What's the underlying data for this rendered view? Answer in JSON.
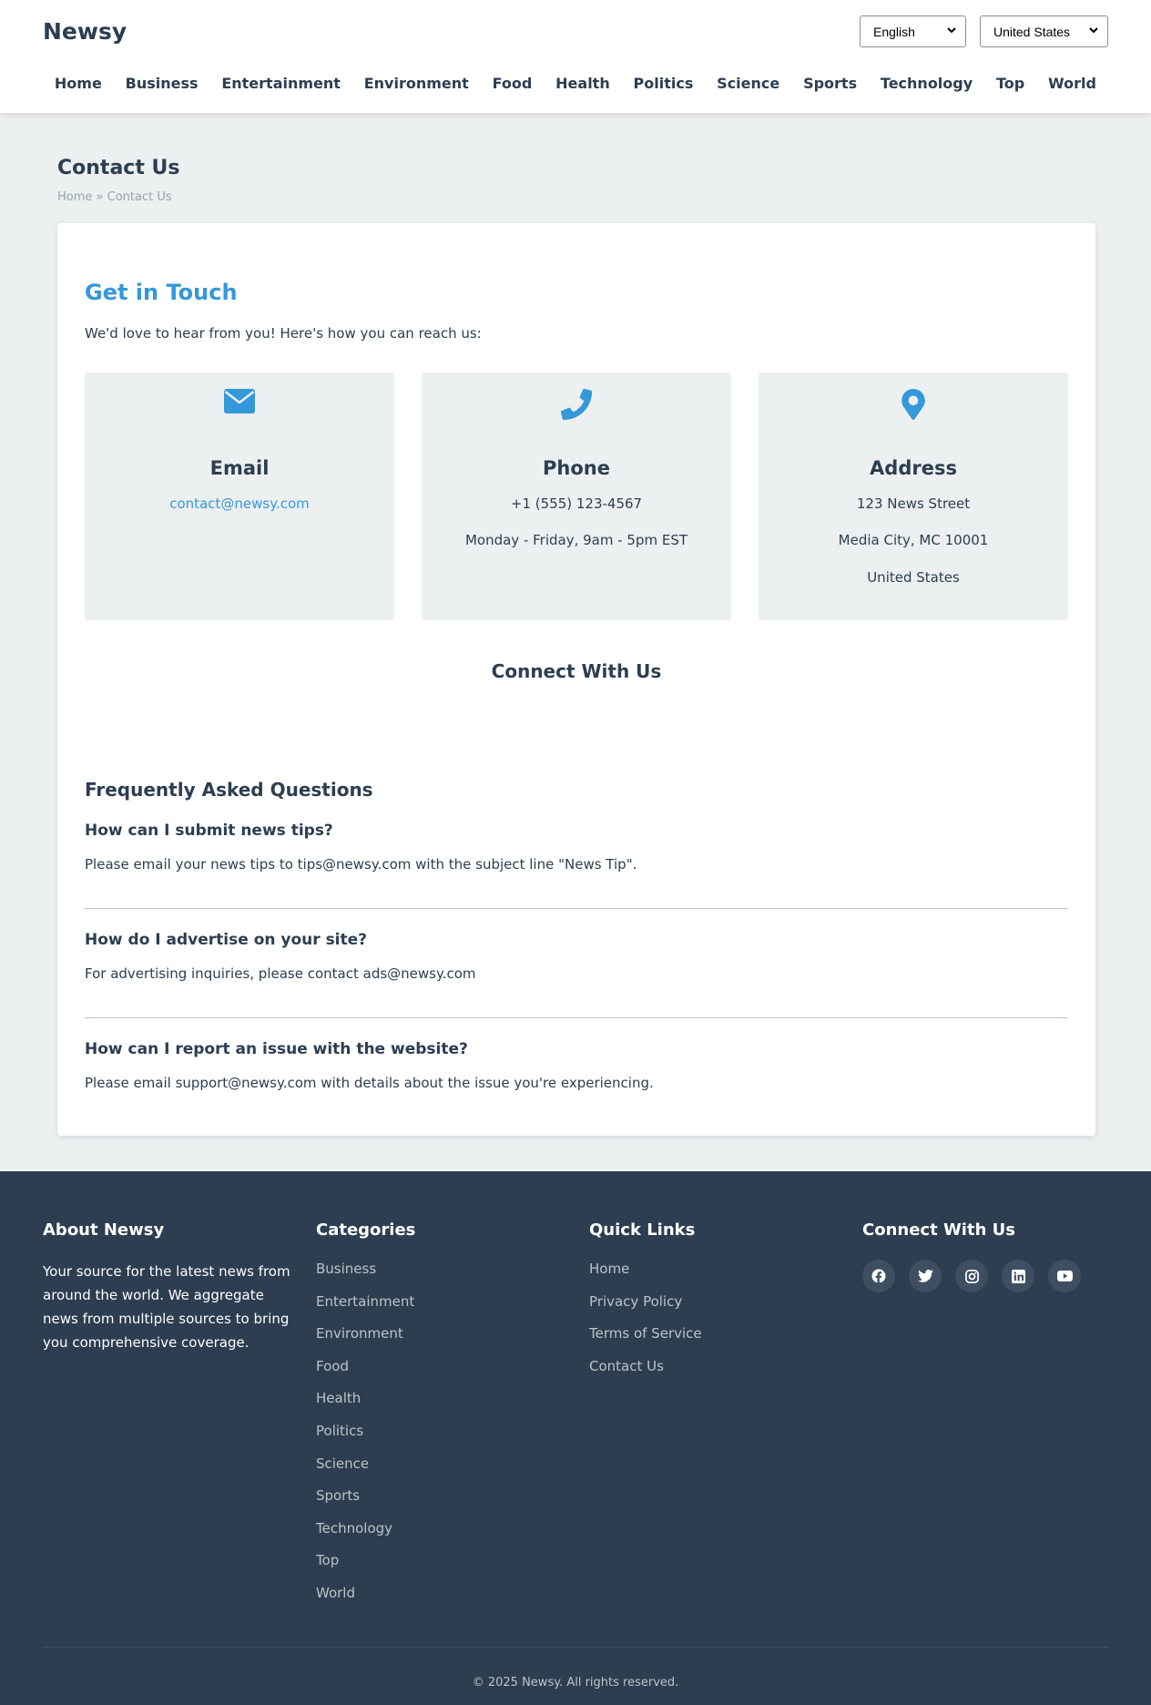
{
  "header": {
    "brand": "Newsy",
    "language_select": "English",
    "country_select": "United States",
    "nav": [
      "Home",
      "Business",
      "Entertainment",
      "Environment",
      "Food",
      "Health",
      "Politics",
      "Science",
      "Sports",
      "Technology",
      "Top",
      "World"
    ]
  },
  "page": {
    "title": "Contact Us",
    "breadcrumb_home": "Home",
    "breadcrumb_sep": "»",
    "breadcrumb_current": "Contact Us"
  },
  "contact": {
    "heading": "Get in Touch",
    "intro": "We'd love to hear from you! Here's how you can reach us:",
    "email": {
      "title": "Email",
      "value": "contact@newsy.com",
      "icon": "envelope-icon"
    },
    "phone": {
      "title": "Phone",
      "number": "+1 (555) 123-4567",
      "hours": "Monday - Friday, 9am - 5pm EST",
      "icon": "phone-icon"
    },
    "address": {
      "title": "Address",
      "street": "123 News Street",
      "city": "Media City, MC 10001",
      "country": "United States",
      "icon": "map-pin-icon"
    },
    "connect_heading": "Connect With Us"
  },
  "faq": {
    "heading": "Frequently Asked Questions",
    "items": [
      {
        "q": "How can I submit news tips?",
        "a": "Please email your news tips to tips@newsy.com with the subject line \"News Tip\"."
      },
      {
        "q": "How do I advertise on your site?",
        "a": "For advertising inquiries, please contact ads@newsy.com"
      },
      {
        "q": "How can I report an issue with the website?",
        "a": "Please email support@newsy.com with details about the issue you're experiencing."
      }
    ]
  },
  "footer": {
    "about_title": "About Newsy",
    "about_text": "Your source for the latest news from around the world. We aggregate news from multiple sources to bring you comprehensive coverage.",
    "categories_title": "Categories",
    "categories": [
      "Business",
      "Entertainment",
      "Environment",
      "Food",
      "Health",
      "Politics",
      "Science",
      "Sports",
      "Technology",
      "Top",
      "World"
    ],
    "quick_links_title": "Quick Links",
    "quick_links": [
      "Home",
      "Privacy Policy",
      "Terms of Service",
      "Contact Us"
    ],
    "connect_title": "Connect With Us",
    "socials": [
      "facebook-icon",
      "twitter-icon",
      "instagram-icon",
      "linkedin-icon",
      "youtube-icon"
    ],
    "copyright": "© 2025 Newsy. All rights reserved."
  },
  "colors": {
    "accent": "#3498db",
    "text": "#2c3e50",
    "page_bg": "#ecf0f1",
    "footer_bg": "#2c3e50"
  }
}
